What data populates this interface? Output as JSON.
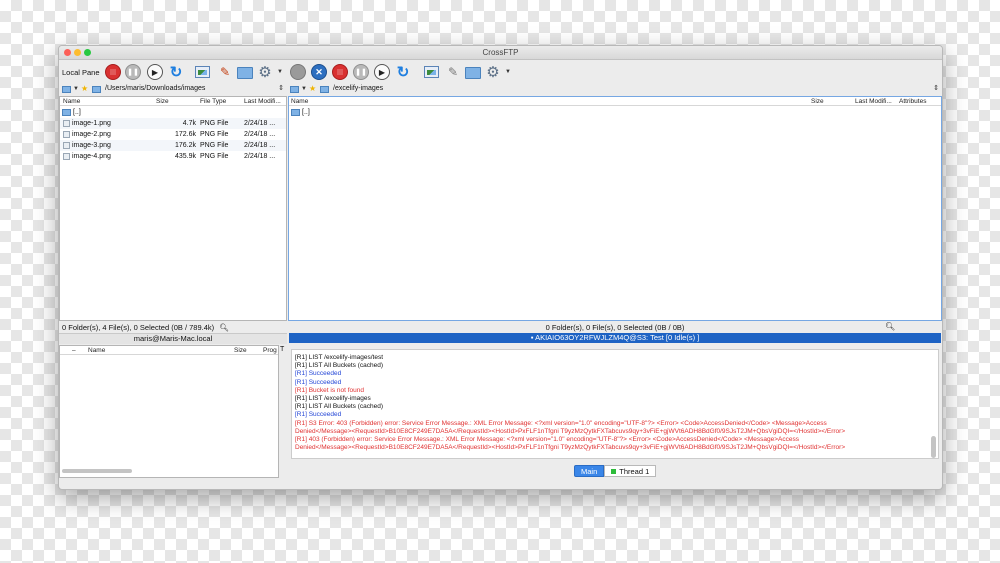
{
  "window": {
    "title": "CrossFTP"
  },
  "toolbar": {
    "local_pane_label": "Local Pane"
  },
  "left": {
    "path": "/Users/maris/Downloads/images",
    "columns": [
      "Name",
      "Size",
      "File Type",
      "Last Modifi..."
    ],
    "parent": "[..]",
    "files": [
      {
        "name": "image-1.png",
        "size": "4.7k",
        "type": "PNG File",
        "modified": "2/24/18 ..."
      },
      {
        "name": "image-2.png",
        "size": "172.6k",
        "type": "PNG File",
        "modified": "2/24/18 ..."
      },
      {
        "name": "image-3.png",
        "size": "176.2k",
        "type": "PNG File",
        "modified": "2/24/18 ..."
      },
      {
        "name": "image-4.png",
        "size": "435.9k",
        "type": "PNG File",
        "modified": "2/24/18 ..."
      }
    ],
    "status": "0 Folder(s), 4 File(s), 0 Selected (0B / 789.4k)",
    "host": "maris@Maris-Mac.local"
  },
  "right": {
    "path": "/excelify-images",
    "columns": [
      "Name",
      "Size",
      "Last Modifi...",
      "Attributes"
    ],
    "parent": "[..]",
    "status": "0 Folder(s), 0 File(s), 0 Selected (0B / 0B)",
    "host": "AKIAIO63OY2RFWJLZM4Q@S3: Test [0 Idle(s) ]"
  },
  "queue": {
    "columns": [
      "Name",
      "Size",
      "Prog",
      "T"
    ]
  },
  "log": [
    {
      "text": "[R1] LIST /excelify-images/test",
      "color": "black"
    },
    {
      "text": "[R1] LIST All Buckets (cached)",
      "color": "black"
    },
    {
      "text": "[R1] Succeeded",
      "color": "blue"
    },
    {
      "text": "[R1] Succeeded",
      "color": "blue"
    },
    {
      "text": "[R1] Bucket is not found",
      "color": "red"
    },
    {
      "text": "[R1] LIST /excelify-images",
      "color": "black"
    },
    {
      "text": "[R1] LIST All Buckets (cached)",
      "color": "black"
    },
    {
      "text": "[R1] Succeeded",
      "color": "blue"
    },
    {
      "text": "[R1] S3 Error: 403 (Forbidden) error: Service Error Message.: XML Error Message: <?xml version=\"1.0\" encoding=\"UTF-8\"?> <Error> <Code>AccessDenied</Code> <Message>Access",
      "color": "red"
    },
    {
      "text": "Denied</Message><RequestId>B10E8CF249E7DA5A</RequestId><HostId>PxFLF1nTfgni T9yzMzQytkFXTabcuvs9qy+3vFiE+gjWVt6ADH8BdGf0/9SJsT2JM+QbsVgiDQI=</HostId></Error>",
      "color": "red"
    },
    {
      "text": "[R1] 403 (Forbidden) error: Service Error Message.: XML Error Message: <?xml version=\"1.0\" encoding=\"UTF-8\"?> <Error> <Code>AccessDenied</Code> <Message>Access",
      "color": "red"
    },
    {
      "text": "Denied</Message><RequestId>B10E8CF249E7DA5A</RequestId><HostId>PxFLF1nTfgni T9yzMzQytkFXTabcuvs9qy+3vFiE+gjWVt6ADH8BdGf0/9SJsT2JM+QbsVgiDQI=</HostId></Error>",
      "color": "red"
    }
  ],
  "tabs": {
    "main": "Main",
    "thread": "Thread 1"
  },
  "icons": {
    "left_toolbar": [
      "stop-icon",
      "pause-icon",
      "play-icon",
      "refresh-icon",
      "image-view-icon",
      "edit-icon",
      "new-folder-icon",
      "settings-icon"
    ],
    "right_toolbar": [
      "connect-icon",
      "disconnect-icon",
      "stop-icon",
      "pause-icon",
      "play-icon",
      "refresh-icon",
      "image-view-icon",
      "edit-icon",
      "new-folder-icon",
      "settings-icon"
    ]
  },
  "colors": {
    "accent": "#1e63c4",
    "error": "#e03131",
    "info": "#2345d6"
  }
}
